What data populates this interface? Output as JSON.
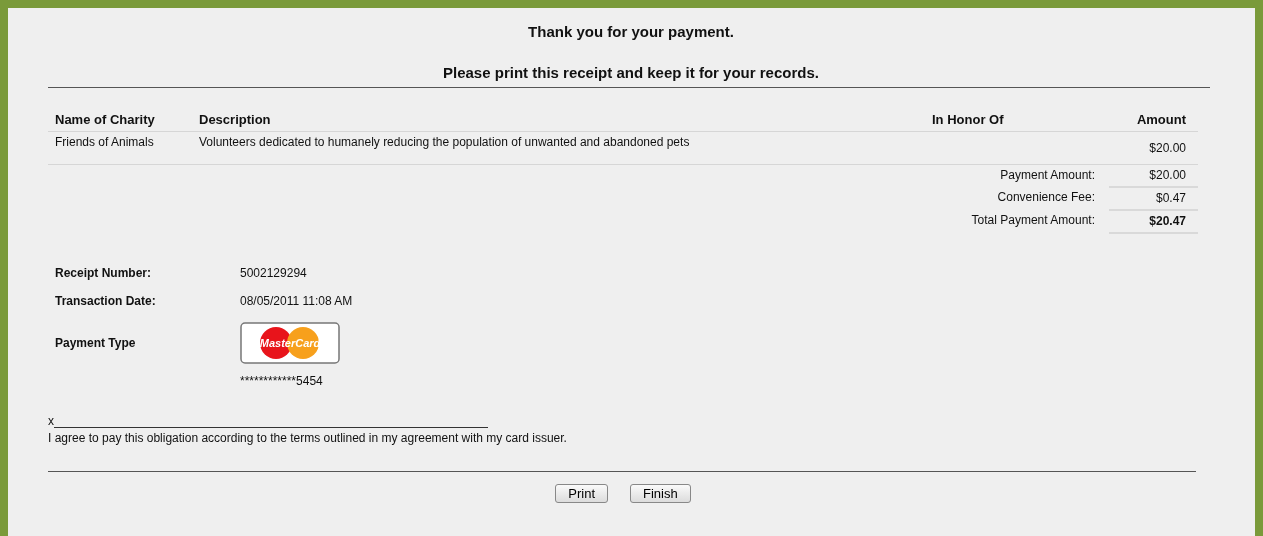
{
  "heading": "Thank you for your payment.",
  "subheading": "Please print this receipt and keep it for your records.",
  "table": {
    "columns": [
      "Name of Charity",
      "Description",
      "In Honor Of",
      "Amount"
    ],
    "rows": [
      {
        "charity": "Friends of Animals",
        "description": "Volunteers dedicated to humanely reducing the population of unwanted and abandoned pets",
        "amount": "$20.00"
      }
    ]
  },
  "totals": [
    {
      "label": "Payment Amount:",
      "value": "$20.00",
      "bold": false
    },
    {
      "label": "Convenience Fee:",
      "value": "$0.47",
      "bold": false
    },
    {
      "label": "Total Payment Amount:",
      "value": "$20.47",
      "bold": true
    }
  ],
  "details": [
    {
      "label": "Receipt Number:",
      "value": "5002129294"
    },
    {
      "label": "Transaction Date:",
      "value": "08/05/2011 11:08 AM"
    }
  ],
  "payment": {
    "label": "Payment Type",
    "logo_text": "MasterCard",
    "card_number": "************5454"
  },
  "signature": {
    "mark": "x",
    "agreement": "I agree to pay this obligation according to the terms outlined in my agreement with my card issuer."
  },
  "buttons": [
    "Print",
    "Finish"
  ]
}
